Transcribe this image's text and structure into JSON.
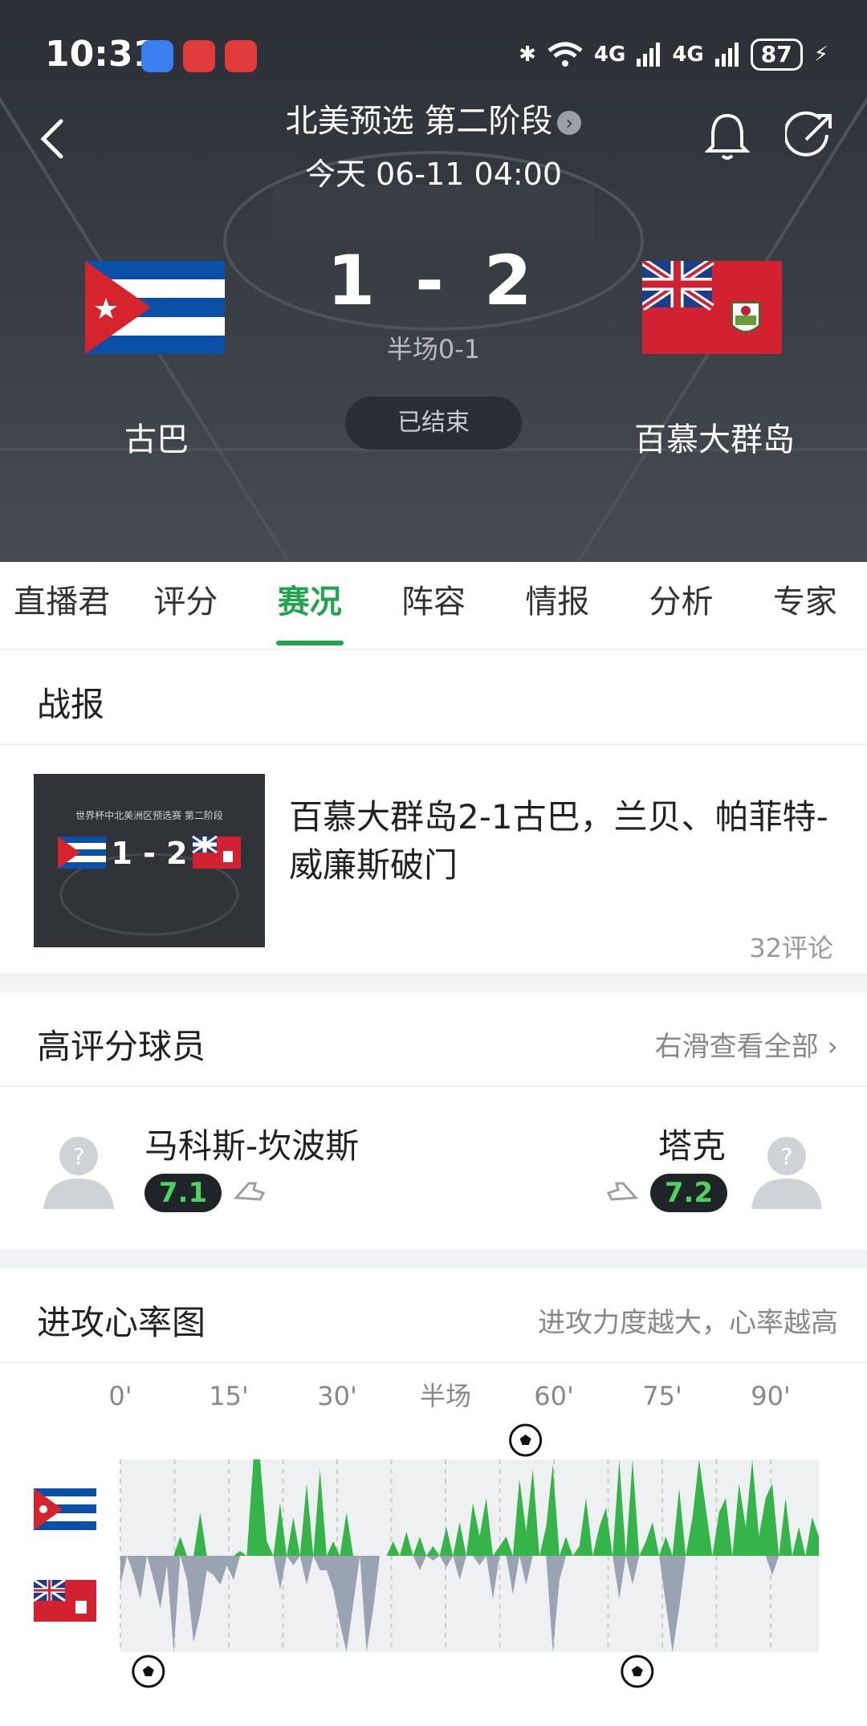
{
  "status_bar": {
    "time": "10:31",
    "battery": "87",
    "net1": "4G",
    "net2": "4G"
  },
  "header": {
    "competition": "北美预选 第二阶段",
    "datetime": "今天 06-11 04:00",
    "home_team": "古巴",
    "away_team": "百慕大群岛",
    "score": "1 - 2",
    "halftime": "半场0-1",
    "match_state": "已结束"
  },
  "tabs": [
    {
      "label": "直播君",
      "active": false
    },
    {
      "label": "评分",
      "active": false
    },
    {
      "label": "赛况",
      "active": true
    },
    {
      "label": "阵容",
      "active": false
    },
    {
      "label": "情报",
      "active": false
    },
    {
      "label": "分析",
      "active": false
    },
    {
      "label": "专家",
      "active": false
    }
  ],
  "report": {
    "section_title": "战报",
    "thumb_caption": "世界杯中北美洲区预选赛 第二阶段",
    "thumb_score": "1 - 2",
    "headline": "百慕大群岛2-1古巴，兰贝、帕菲特-威廉斯破门",
    "comments": "32评论"
  },
  "top_players": {
    "section_title": "高评分球员",
    "more": "右滑查看全部",
    "home": {
      "name": "马科斯-坎波斯",
      "rating": "7.1"
    },
    "away": {
      "name": "塔克",
      "rating": "7.2"
    }
  },
  "heart": {
    "section_title": "进攻心率图",
    "hint": "进攻力度越大，心率越高",
    "time_labels": [
      "0'",
      "15'",
      "30'",
      "半场",
      "60'",
      "75'",
      "90'"
    ]
  },
  "chart_data": {
    "type": "area",
    "x_ticks": [
      "0'",
      "15'",
      "30'",
      "半场",
      "60'",
      "75'",
      "90'"
    ],
    "series": [
      {
        "team": "古巴",
        "color": "#35b549",
        "values": [
          0,
          0,
          0,
          0,
          0,
          0,
          0,
          0,
          0,
          0.2,
          0,
          0,
          0.45,
          0,
          0,
          0,
          0,
          0,
          0.05,
          0,
          1,
          1,
          0.15,
          0,
          0.55,
          0,
          0.4,
          0,
          0.75,
          0,
          0.9,
          0,
          0.15,
          0,
          0.45,
          0,
          0,
          0,
          0,
          0,
          0,
          0.15,
          0,
          0.25,
          0,
          0.2,
          0,
          0.1,
          0,
          0.3,
          0,
          0.35,
          0,
          0.55,
          0.2,
          0.6,
          0,
          0.1,
          0.2,
          0,
          0.8,
          0.25,
          0.9,
          0,
          0.3,
          0.95,
          0,
          0.2,
          0,
          0.1,
          0.6,
          0,
          0.3,
          0.5,
          0,
          1,
          0,
          1,
          0,
          0.15,
          0.35,
          0,
          0.2,
          0,
          0.7,
          0,
          0.4,
          1,
          0.5,
          0,
          0.45,
          0.6,
          0,
          0.75,
          0.3,
          1,
          0.2,
          0.6,
          0.75,
          0,
          0.6,
          0,
          0.3,
          0,
          0.4,
          0.2
        ]
      },
      {
        "team": "百慕大群岛",
        "color": "#9aa3b2",
        "values": [
          0.3,
          0,
          0.2,
          0.45,
          0,
          0.25,
          0.55,
          0.1,
          1,
          0,
          0.25,
          0.9,
          0.6,
          0.15,
          0.2,
          0.3,
          0.1,
          0.25,
          0,
          0,
          0,
          0,
          0,
          0,
          0.35,
          0,
          0.1,
          0,
          0.3,
          0,
          0.15,
          0.15,
          0.35,
          0.7,
          1,
          0.5,
          0,
          1,
          0.55,
          0,
          0,
          0,
          0,
          0,
          0,
          0.15,
          0,
          0.05,
          0,
          0.12,
          0,
          0.25,
          0,
          0,
          0.1,
          0,
          0.45,
          0,
          0,
          0.4,
          0,
          0.3,
          0,
          0,
          0,
          1,
          0.25,
          0,
          0,
          0,
          0,
          0,
          0,
          0,
          0,
          0.45,
          0,
          0.3,
          0,
          0,
          0,
          0,
          0.5,
          1,
          0.55,
          0,
          0,
          0,
          0,
          0,
          0,
          0,
          0,
          0,
          0,
          0,
          0,
          0,
          0.2,
          0,
          0,
          0,
          0,
          0,
          0,
          0
        ]
      }
    ],
    "goals": [
      {
        "team": "古巴",
        "minute": 58
      },
      {
        "team": "百慕大群岛",
        "minute": 4
      },
      {
        "team": "百慕大群岛",
        "minute": 74
      }
    ]
  }
}
